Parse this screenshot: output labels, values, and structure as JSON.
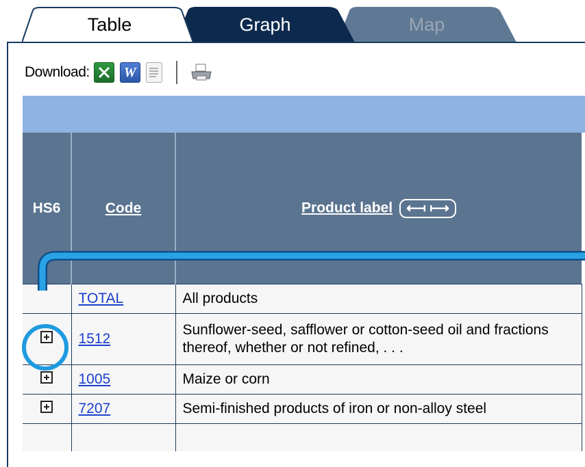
{
  "tabs": [
    {
      "label": "Table"
    },
    {
      "label": "Graph"
    },
    {
      "label": "Map"
    }
  ],
  "toolbar": {
    "download_label": "Download:",
    "icons": [
      "excel-icon",
      "word-icon",
      "text-file-icon",
      "print-icon"
    ]
  },
  "table": {
    "headers": {
      "hs6": "HS6",
      "code": "Code",
      "product": "Product label",
      "arrows": "⟻ ⟼"
    },
    "rows": [
      {
        "code": "TOTAL",
        "label": "All products",
        "expand": false
      },
      {
        "code": "1512",
        "label": "Sunflower-seed, safflower or cotton-seed oil and fractions thereof, whether or not refined, . . .",
        "expand": true
      },
      {
        "code": "1005",
        "label": "Maize or corn",
        "expand": true
      },
      {
        "code": "7207",
        "label": "Semi-finished products of iron or non-alloy steel",
        "expand": true
      }
    ]
  },
  "colors": {
    "tab_active": "#ffffff",
    "tab_graph": "#0d2a4e",
    "tab_map": "#5f7994",
    "header_bg": "#5b7490",
    "band": "#8db4e2",
    "highlight": "#1e9be0",
    "link": "#1a3fd0"
  }
}
